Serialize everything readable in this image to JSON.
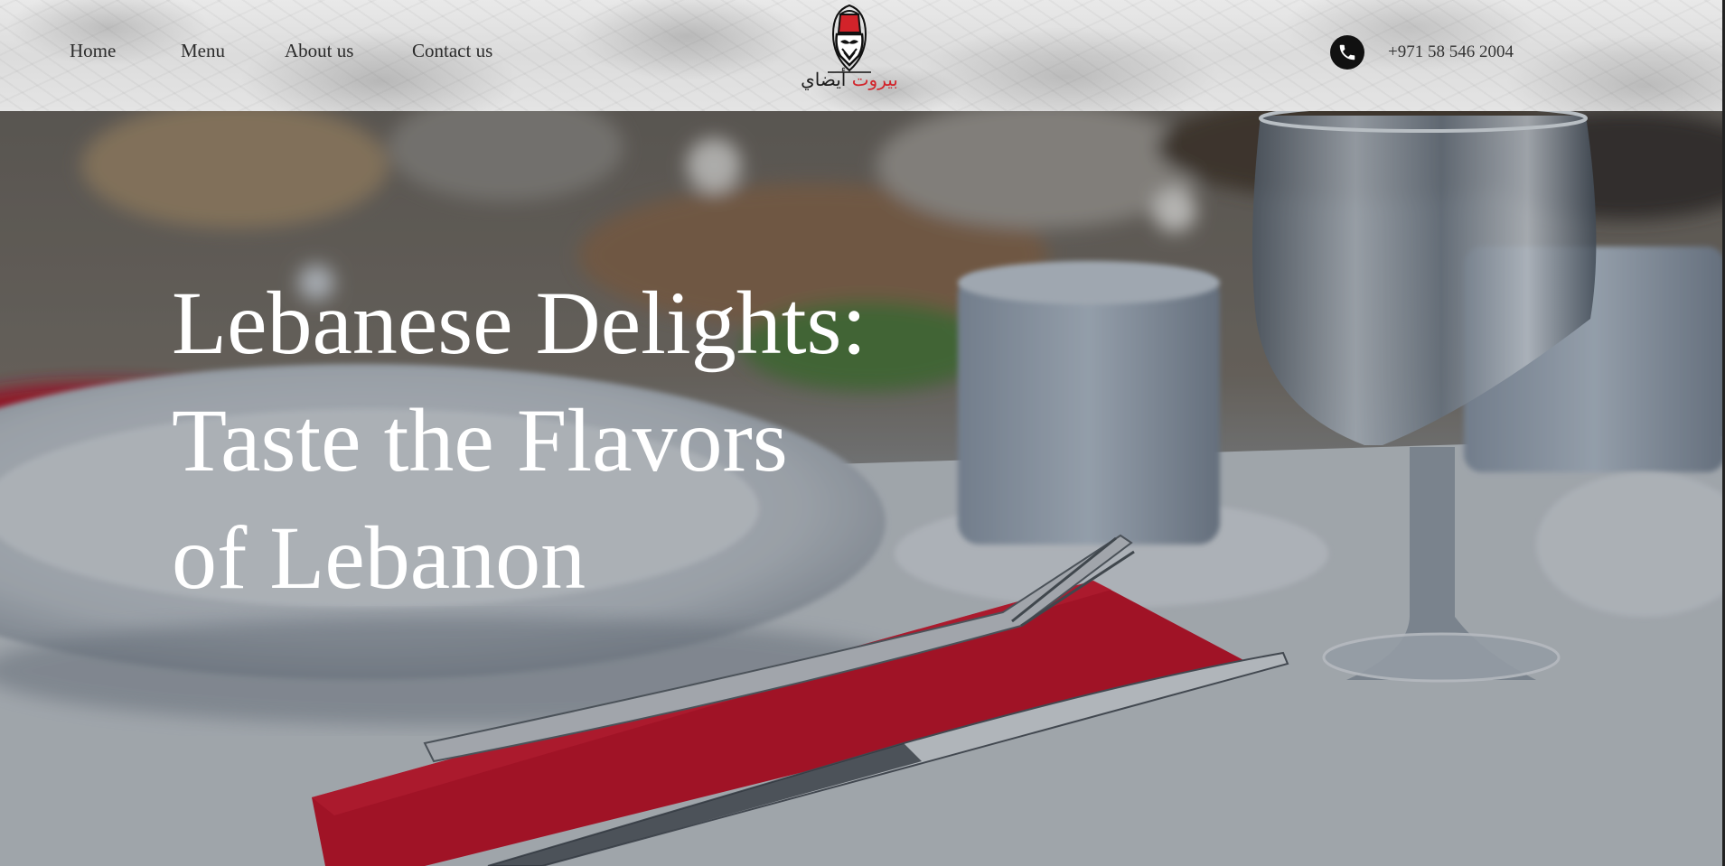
{
  "header": {
    "nav": [
      {
        "label": "Home"
      },
      {
        "label": "Menu"
      },
      {
        "label": "About us"
      },
      {
        "label": "Contact us"
      }
    ],
    "logo": {
      "arabic_black": "أيضاي",
      "arabic_red": "بيروت"
    },
    "phone": {
      "number": "+971 58 546 2004",
      "icon": "phone-icon"
    }
  },
  "hero": {
    "title": "Lebanese Delights: Taste the Flavors of Lebanon",
    "background": "table-setting-photo"
  },
  "colors": {
    "accent_red": "#d2232a",
    "nav_text": "#2c2c2c",
    "hero_text": "#ffffff"
  }
}
